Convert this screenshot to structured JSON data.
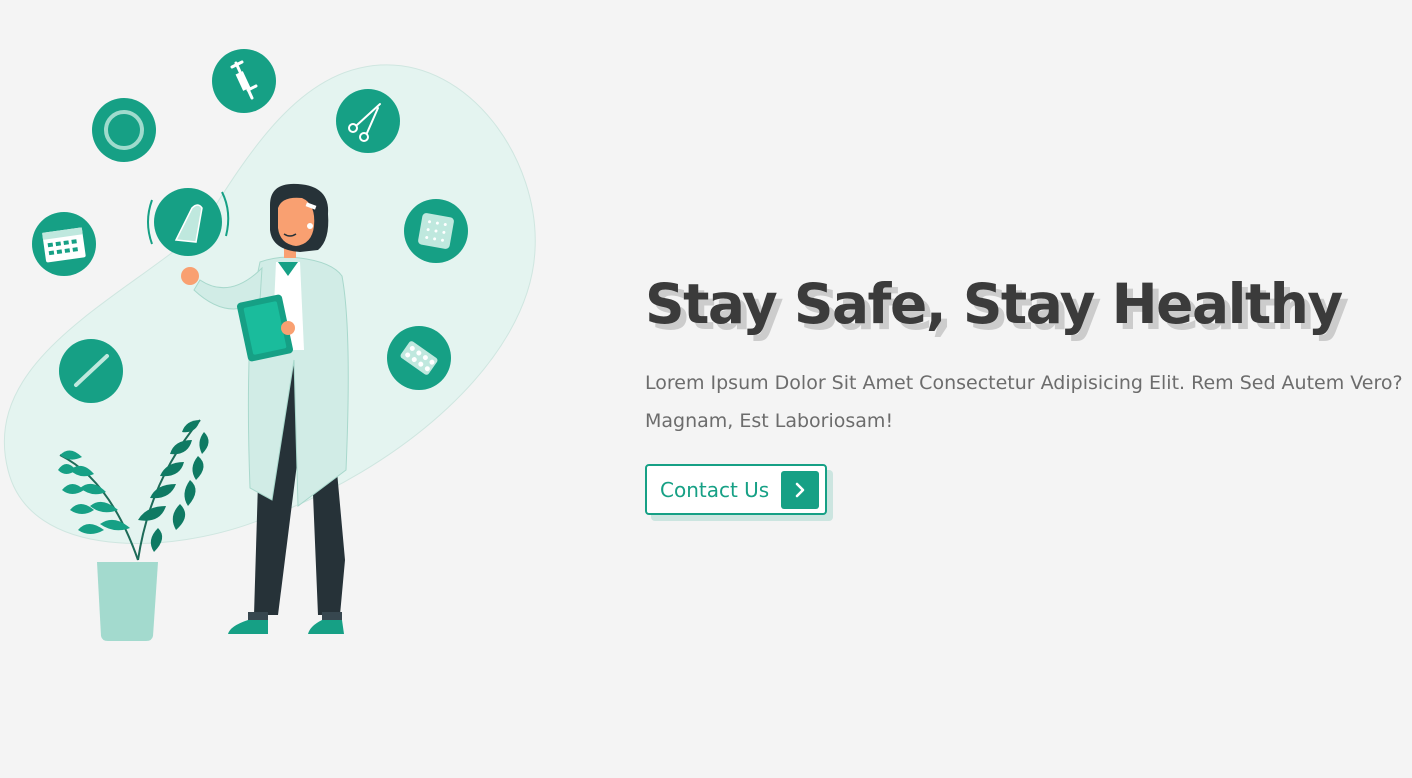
{
  "hero": {
    "title": "Stay Safe, Stay Healthy",
    "description": "Lorem Ipsum Dolor Sit Amet Consectetur Adipisicing Elit. Rem Sed Autem Vero? Magnam, Est Laboriosam!",
    "cta_label": "Contact Us",
    "cta_icon": "chevron-right-icon"
  },
  "colors": {
    "accent": "#16a085",
    "background": "#f4f4f4",
    "title": "#3b3b3b",
    "text": "#6c6c6c"
  },
  "illustration": {
    "subject": "doctor-illustration",
    "icons": [
      "syringe-icon",
      "ring-icon",
      "scissors-icon",
      "condom-icon",
      "calendar-icon",
      "contraceptive-patch-icon",
      "thermometer-icon",
      "pill-pack-icon",
      "plant-icon"
    ]
  }
}
